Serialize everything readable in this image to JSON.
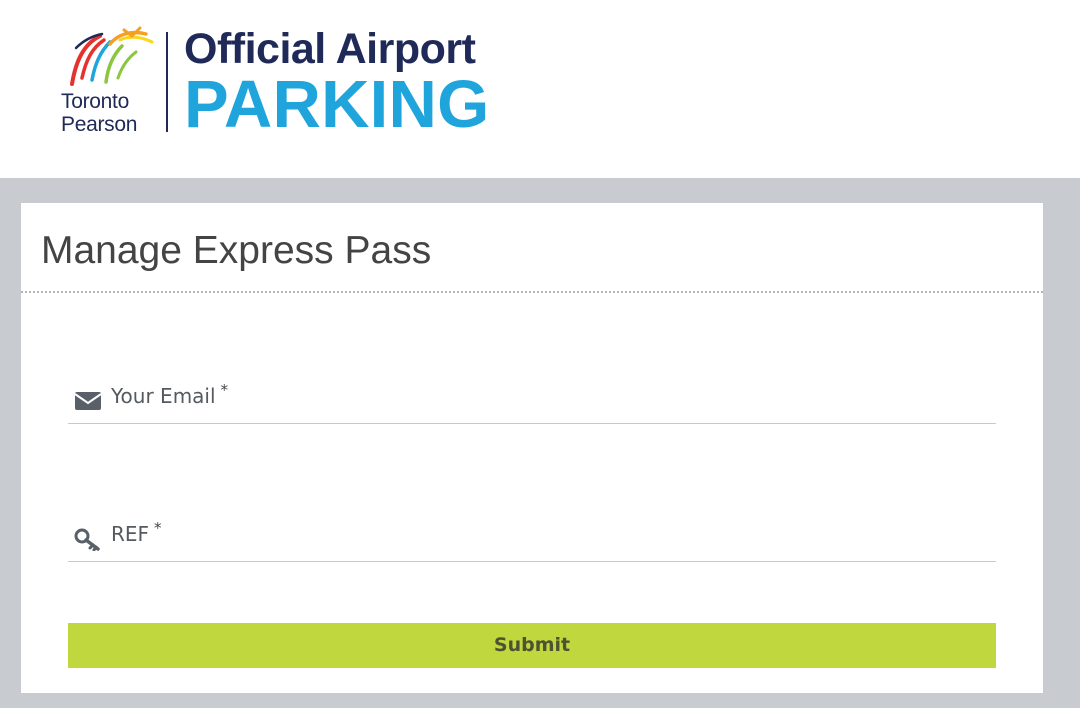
{
  "header": {
    "logo": {
      "airport_name_line1": "Toronto",
      "airport_name_line2": "Pearson",
      "brand_line1": "Official Airport",
      "brand_line2": "PARKING",
      "mark_icon": "pearson-bird-icon",
      "colors": {
        "navy": "#1f2a58",
        "blue": "#1fa5dc",
        "red": "#e5322d",
        "orange": "#f4a024",
        "green": "#8cc63f",
        "yellow": "#f9d71c"
      }
    }
  },
  "form": {
    "title": "Manage Express Pass",
    "fields": [
      {
        "label": "Your Email",
        "required_mark": "*",
        "icon": "envelope-icon",
        "value": ""
      },
      {
        "label": "REF",
        "required_mark": "*",
        "icon": "key-icon",
        "value": ""
      }
    ],
    "submit_label": "Submit"
  },
  "colors": {
    "page_background": "#c8ccd0",
    "card_background": "#ffffff",
    "button_background": "#c0d73e",
    "button_text": "#4d5231",
    "label_text": "#555a60",
    "title_text": "#444444"
  }
}
